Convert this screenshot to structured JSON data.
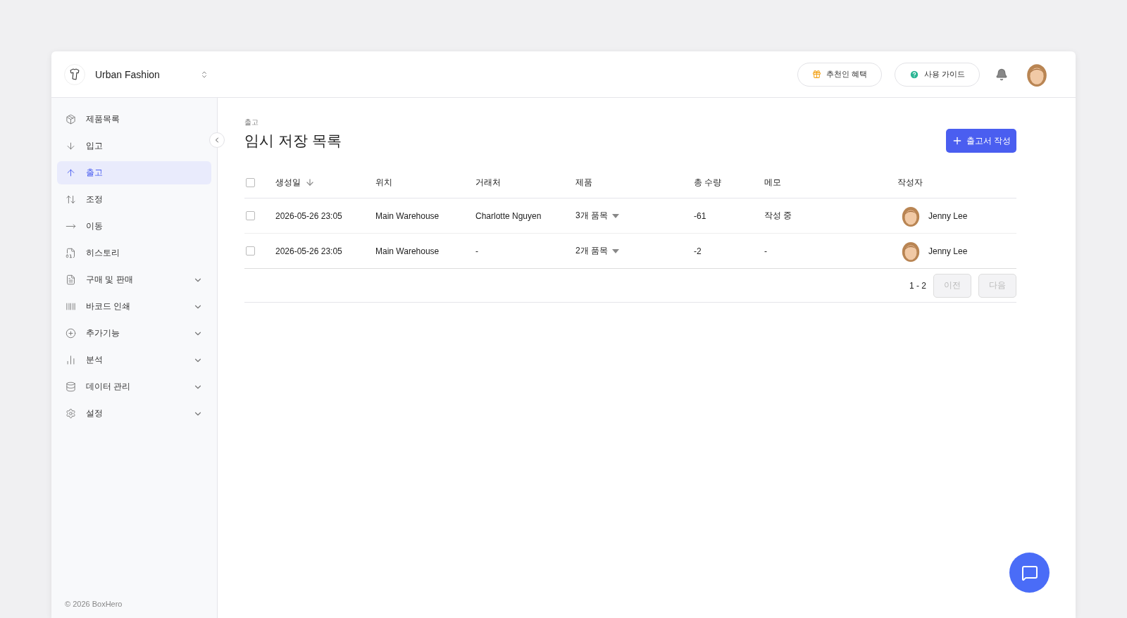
{
  "workspace": {
    "name": "Urban Fashion"
  },
  "header": {
    "buttons": [
      {
        "kind": "gift",
        "label": "추천인 혜택"
      },
      {
        "kind": "help",
        "label": "사용 가이드"
      }
    ]
  },
  "sidebar": {
    "items": [
      {
        "label": "제품목록",
        "selected": false,
        "expandable": false
      },
      {
        "label": "입고",
        "selected": false,
        "expandable": false
      },
      {
        "label": "출고",
        "selected": true,
        "expandable": false
      },
      {
        "label": "조정",
        "selected": false,
        "expandable": false
      },
      {
        "label": "이동",
        "selected": false,
        "expandable": false
      },
      {
        "label": "히스토리",
        "selected": false,
        "expandable": false
      },
      {
        "label": "구매 및 판매",
        "selected": false,
        "expandable": true
      },
      {
        "label": "바코드 인쇄",
        "selected": false,
        "expandable": true
      },
      {
        "label": "추가기능",
        "selected": false,
        "expandable": true
      },
      {
        "label": "분석",
        "selected": false,
        "expandable": true
      },
      {
        "label": "데이터 관리",
        "selected": false,
        "expandable": true
      },
      {
        "label": "설정",
        "selected": false,
        "expandable": true
      }
    ],
    "footer": "© 2026 BoxHero"
  },
  "page": {
    "breadcrumb": "출고",
    "title": "임시 저장 목록",
    "create_button": "출고서 작성"
  },
  "table": {
    "header_checked": false,
    "columns": [
      "생성일",
      "위치",
      "거래처",
      "제품",
      "총 수량",
      "메모",
      "작성자"
    ],
    "rows": [
      {
        "checked": false,
        "created": "2026-05-26 23:05",
        "location": "Main Warehouse",
        "partner": "Charlotte Nguyen",
        "products": "3개 품목",
        "quantity": "-61",
        "memo": "작성 중",
        "author": "Jenny Lee"
      },
      {
        "checked": false,
        "created": "2026-05-26 23:05",
        "location": "Main Warehouse",
        "partner": "-",
        "products": "2개 품목",
        "quantity": "-2",
        "memo": "-",
        "author": "Jenny Lee"
      }
    ]
  },
  "pagination": {
    "range": "1 - 2",
    "prev": {
      "label": "이전",
      "disabled": true
    },
    "next": {
      "label": "다음",
      "disabled": true
    }
  }
}
